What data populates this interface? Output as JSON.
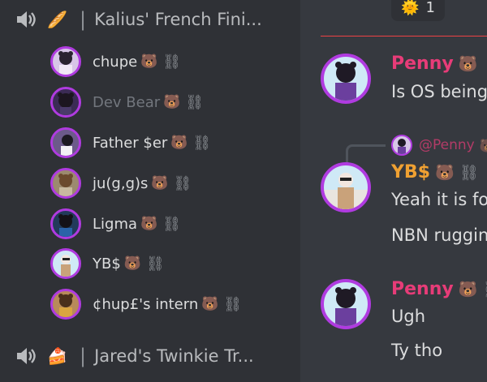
{
  "sidebar": {
    "channels": [
      {
        "emoji": "🥖",
        "separator": "|",
        "name": "Kalius' French Fini..."
      },
      {
        "emoji": "🍰",
        "separator": "|",
        "name": "Jared's Twinkie Tr..."
      }
    ],
    "users": [
      {
        "name": "chupe",
        "bear": "🐻",
        "chain": "⛓",
        "dim": false
      },
      {
        "name": "Dev Bear",
        "bear": "🐻",
        "chain": "⛓",
        "dim": true
      },
      {
        "name": "Father $er",
        "bear": "🐻",
        "chain": "⛓",
        "dim": false
      },
      {
        "name": "ju(g,g)s",
        "bear": "🐻",
        "chain": "⛓",
        "dim": false
      },
      {
        "name": "Ligma",
        "bear": "🐻",
        "chain": "⛓",
        "dim": false
      },
      {
        "name": "YB$",
        "bear": "🐻",
        "chain": "⛓",
        "dim": false
      },
      {
        "name": "¢hup£'s intern",
        "bear": "🐻",
        "chain": "⛓",
        "dim": false
      }
    ]
  },
  "chat": {
    "reaction": {
      "emoji": "🌞",
      "count": "1"
    },
    "messages": [
      {
        "author": "Penny",
        "author_color": "#e73c78",
        "bear": "🐻",
        "chain": "",
        "lines": [
          "Is OS being"
        ]
      },
      {
        "reply_to": "@Penny",
        "reply_bear": "🐻",
        "author": "YB$",
        "author_color": "#f0a132",
        "bear": "🐻",
        "chain": "⛓",
        "lines": [
          "Yeah it is fo",
          "NBN ruggin"
        ]
      },
      {
        "author": "Penny",
        "author_color": "#e73c78",
        "bear": "🐻",
        "chain": "⛓",
        "lines": [
          "Ugh",
          "Ty tho"
        ]
      }
    ]
  }
}
